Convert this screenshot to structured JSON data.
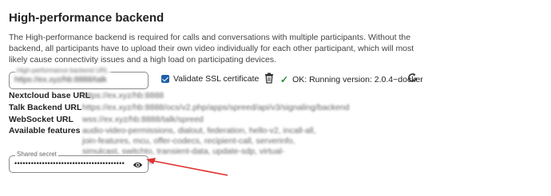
{
  "section": {
    "title": "High-performance backend",
    "description": "The High-performance backend is required for calls and conversations with multiple participants. Without the backend, all participants have to upload their own video individually for each other participant, which will most likely cause connectivity issues and a high load on participating devices."
  },
  "backend_field": {
    "legend": "High-performance backend URL",
    "value": "https://ex.xyz/hb:8888/talk"
  },
  "ssl": {
    "label": "Validate SSL certificate",
    "checked": true
  },
  "status": {
    "text": "OK: Running version: 2.0.4~docker",
    "color": "#2d8a2d"
  },
  "info_rows": [
    {
      "label": "Nextcloud base URL",
      "value": "https://ex.xyz/hb:8888"
    },
    {
      "label": "Talk Backend URL",
      "value": "https://ex.xyz/hb:8888/ocs/v2.php/apps/spreed/api/v3/signaling/backend"
    },
    {
      "label": "WebSocket URL",
      "value": "wss://ex.xyz/hb:8888/talk/spreed"
    },
    {
      "label": "Available features",
      "value": "audio-video-permissions, dialout, federation, hello-v2, incall-all, join-features, mcu, offer-codecs, recipient-call, serverinfo, simulcast, switchto, transient-data, update-sdp, virtual-sessions, welcome"
    }
  ],
  "secret_field": {
    "legend": "Shared secret",
    "value": "••••••••••••••••••••••••••••••••••••••••"
  },
  "colors": {
    "accent": "#1f5fa8",
    "annotation_arrow": "#e03030"
  },
  "icons": [
    "checkbox-checked-icon",
    "trash-icon",
    "check-icon",
    "refresh-icon",
    "eye-icon",
    "annotation-arrow"
  ]
}
